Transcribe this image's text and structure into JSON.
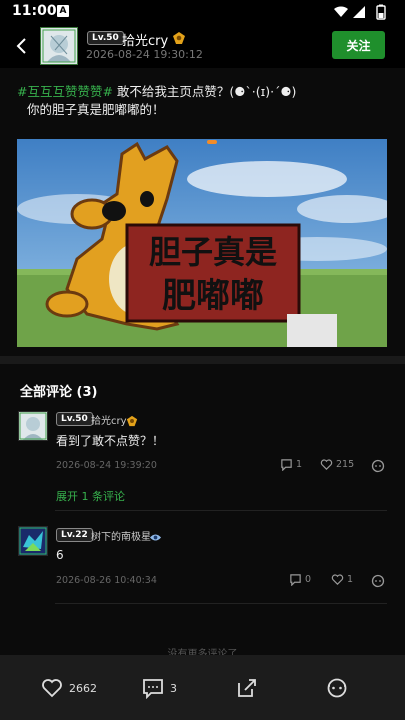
{
  "status_bar": {
    "time": "11:00",
    "notif_letter": "A"
  },
  "header": {
    "level": "Lv.50",
    "username": "拾光cry",
    "date": "2026-08-24 19:30:12",
    "follow_label": "关注"
  },
  "post": {
    "hashtag": "#互互互赞赞赞#",
    "line1_rest": " 敢不给我主页点赞？(⚈ˋ·(ɪ)·ˊ⚈)",
    "line2": "你的胆子真是肥嘟嘟的！",
    "image_text_top": "胆子真是",
    "image_text_bottom": "肥嘟嘟"
  },
  "comments_section": {
    "title": "全部评论 (3)",
    "comments": [
      {
        "level": "Lv.50",
        "name": "拾光cry",
        "text": "看到了敢不点赞？！",
        "date": "2026-08-24 19:39:20",
        "reply_count": "1",
        "like_count": "215",
        "expand_label": "展开 1 条评论"
      },
      {
        "level": "Lv.22",
        "name": "树下的南极星",
        "text": "6",
        "date": "2026-08-26 10:40:34",
        "reply_count": "0",
        "like_count": "1"
      }
    ],
    "no_more": "没有更多评论了"
  },
  "bottom_bar": {
    "likes": "2662",
    "comments": "3"
  },
  "colors": {
    "accent": "#37b24d",
    "follow_bg": "#1f8f2c",
    "background": "#0b0b0b"
  }
}
